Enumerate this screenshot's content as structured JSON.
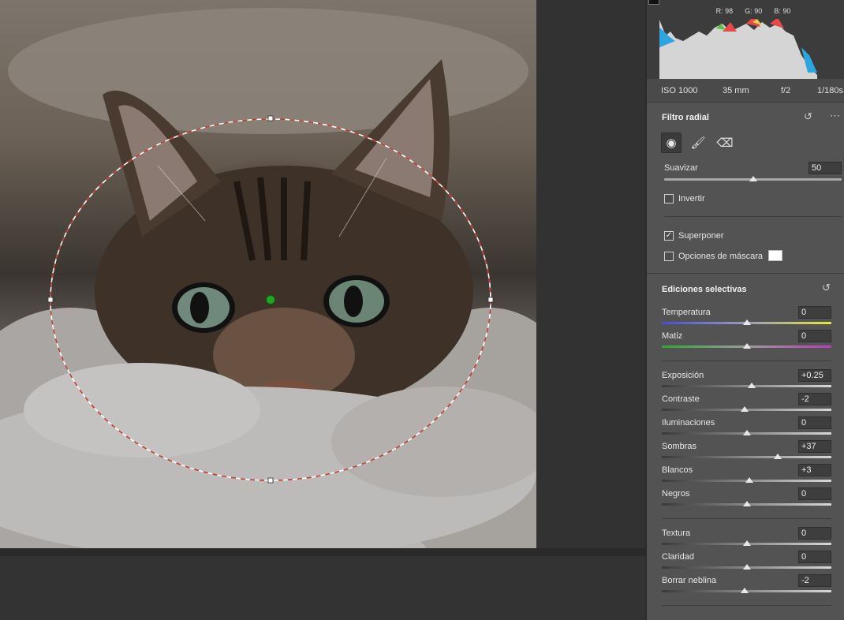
{
  "histogram": {
    "rgb": {
      "r_label": "R:",
      "r_value": "98",
      "g_label": "G:",
      "g_value": "90",
      "b_label": "B:",
      "b_value": "90"
    }
  },
  "exif": {
    "iso": "ISO 1000",
    "focal": "35 mm",
    "aperture": "f/2",
    "shutter": "1/180s"
  },
  "radial_filter": {
    "title": "Filtro radial",
    "reset_icon": "reset-icon",
    "more_icon": "more-icon",
    "tools": [
      "radial-tool-icon",
      "brush-icon",
      "eraser-icon"
    ],
    "feather_label": "Suavizar",
    "feather_value": "50",
    "feather_level": 50,
    "invert_label": "Invertir",
    "invert_checked": false,
    "overlay_label": "Superponer",
    "overlay_checked": true,
    "mask_options_label": "Opciones de máscara",
    "mask_color": "#ffffff"
  },
  "selective_edits": {
    "title": "Ediciones selectivas",
    "reset_icon": "reset-icon",
    "sliders": [
      {
        "label": "Temperatura",
        "value": "0",
        "level": 0.5,
        "kind": "temp"
      },
      {
        "label": "Matiz",
        "value": "0",
        "level": 0.5,
        "kind": "tint"
      },
      {
        "label": "Exposición",
        "value": "+0.25",
        "level": 0.53,
        "kind": "gray"
      },
      {
        "label": "Contraste",
        "value": "-2",
        "level": 0.49,
        "kind": "gray"
      },
      {
        "label": "Iluminaciones",
        "value": "0",
        "level": 0.5,
        "kind": "gray"
      },
      {
        "label": "Sombras",
        "value": "+37",
        "level": 0.685,
        "kind": "gray"
      },
      {
        "label": "Blancos",
        "value": "+3",
        "level": 0.515,
        "kind": "gray"
      },
      {
        "label": "Negros",
        "value": "0",
        "level": 0.5,
        "kind": "gray"
      },
      {
        "label": "Textura",
        "value": "0",
        "level": 0.5,
        "kind": "gray"
      },
      {
        "label": "Claridad",
        "value": "0",
        "level": 0.5,
        "kind": "gray"
      },
      {
        "label": "Borrar neblina",
        "value": "-2",
        "level": 0.49,
        "kind": "gray"
      }
    ]
  },
  "colors": {
    "panel": "#535353",
    "workspace": "#323232",
    "filter_pin": "#1fa81f",
    "mask_line_red": "#c0392b"
  }
}
